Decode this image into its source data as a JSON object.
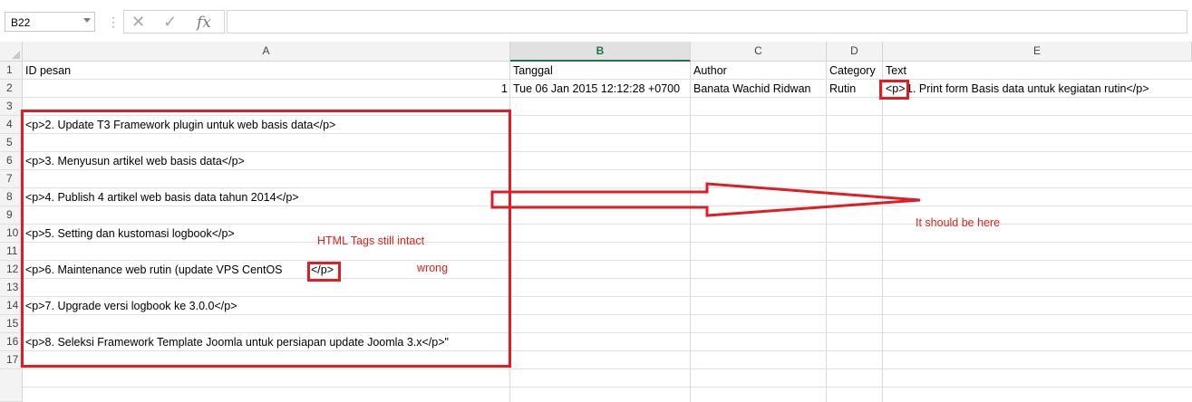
{
  "formula_bar": {
    "name_box": "B22",
    "separator": "⋮",
    "cancel_glyph": "✕",
    "enter_glyph": "✓",
    "fx_glyph": "fx",
    "formula": ""
  },
  "columns": [
    "A",
    "B",
    "C",
    "D",
    "E"
  ],
  "rows": [
    "1",
    "2",
    "3",
    "4",
    "5",
    "6",
    "7",
    "8",
    "9",
    "10",
    "11",
    "12",
    "13",
    "14",
    "15",
    "16",
    "17"
  ],
  "cells": {
    "A1": "ID pesan",
    "B1": "Tanggal",
    "C1": "Author",
    "D1": "Category",
    "E1": "Text",
    "A2": "1",
    "B2": "Tue  06 Jan 2015 12:12:28 +0700",
    "C2": "Banata Wachid Ridwan",
    "D2": "Rutin",
    "E2_tag": "<p>",
    "E2_rest": "1. Print form Basis data untuk kegiatan rutin</p>",
    "A4": "<p>2. Update T3 Framework plugin untuk web basis data</p>",
    "A6": "<p>3. Menyusun artikel web basis data</p>",
    "A8": "<p>4. Publish 4 artikel web basis data tahun 2014</p>",
    "A10": "<p>5. Setting dan kustomasi logbook</p>",
    "A12_text": "<p>6. Maintenance web rutin (update VPS CentOS",
    "A12_tag": "</p>",
    "A14": "<p>7. Upgrade versi logbook ke 3.0.0</p>",
    "A16": "<p>8. Seleksi Framework Template Joomla untuk persiapan update Joomla 3.x</p>\""
  },
  "annotations": {
    "html_tags": "HTML Tags still intact",
    "wrong": "wrong",
    "should_be_here": "It should be here"
  },
  "colors": {
    "annotation_red": "#dc1f26",
    "active_header_green": "#217346"
  }
}
